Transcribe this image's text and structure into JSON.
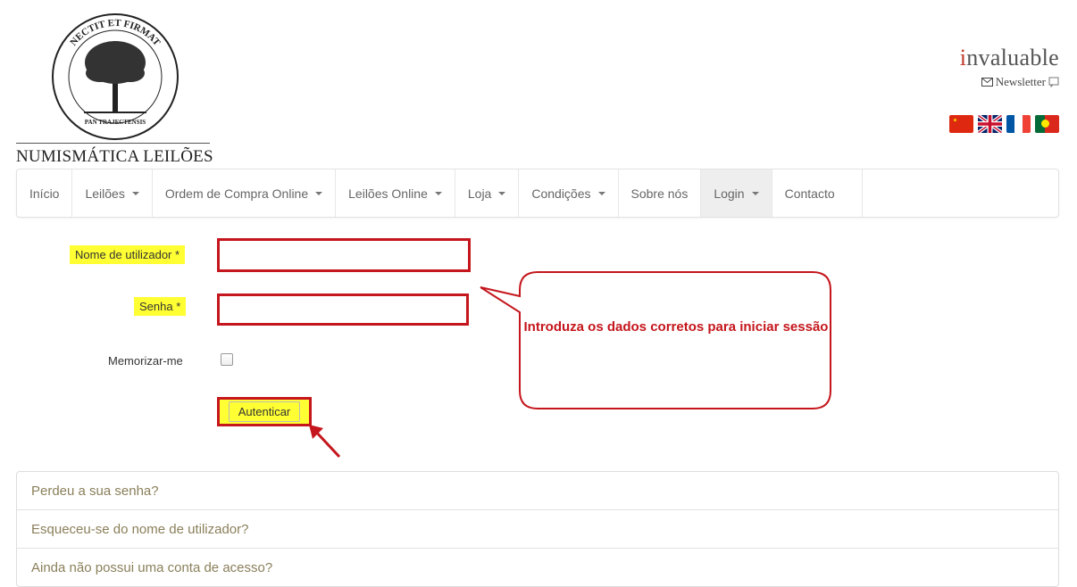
{
  "logo": {
    "name": "NUMISMÁTICA LEILÕES",
    "emblem_text_top": "NECTIT ET FIRMAT",
    "emblem_text_bottom": "PAN TRAJECTENSIS"
  },
  "brand": {
    "name_prefix": "i",
    "name_rest": "nvaluable"
  },
  "newsletter": {
    "label": "Newsletter",
    "icon": "envelope-icon"
  },
  "flags": [
    "china-flag",
    "uk-flag",
    "france-flag",
    "portugal-flag"
  ],
  "nav": {
    "items": [
      {
        "label": "Início",
        "dropdown": false
      },
      {
        "label": "Leilões",
        "dropdown": true
      },
      {
        "label": "Ordem de Compra Online",
        "dropdown": true
      },
      {
        "label": "Leilões Online",
        "dropdown": true
      },
      {
        "label": "Loja",
        "dropdown": true
      },
      {
        "label": "Condições",
        "dropdown": true
      },
      {
        "label": "Sobre nós",
        "dropdown": false
      },
      {
        "label": "Login",
        "dropdown": true,
        "active": true
      },
      {
        "label": "Contacto",
        "dropdown": false
      }
    ]
  },
  "form": {
    "username_label": "Nome de utilizador *",
    "username_value": "",
    "password_label": "Senha *",
    "password_value": "",
    "remember_label": "Memorizar-me",
    "remember_checked": false,
    "submit_label": "Autenticar"
  },
  "callout": {
    "text": "Introduza os dados corretos para iniciar sessão"
  },
  "links": [
    "Perdeu a sua senha?",
    "Esqueceu-se do nome de utilizador?",
    "Ainda não possui uma conta de acesso?"
  ],
  "colors": {
    "highlight": "#ffff33",
    "annotation_red": "#c4161c",
    "link_text": "#8a7f5a"
  }
}
